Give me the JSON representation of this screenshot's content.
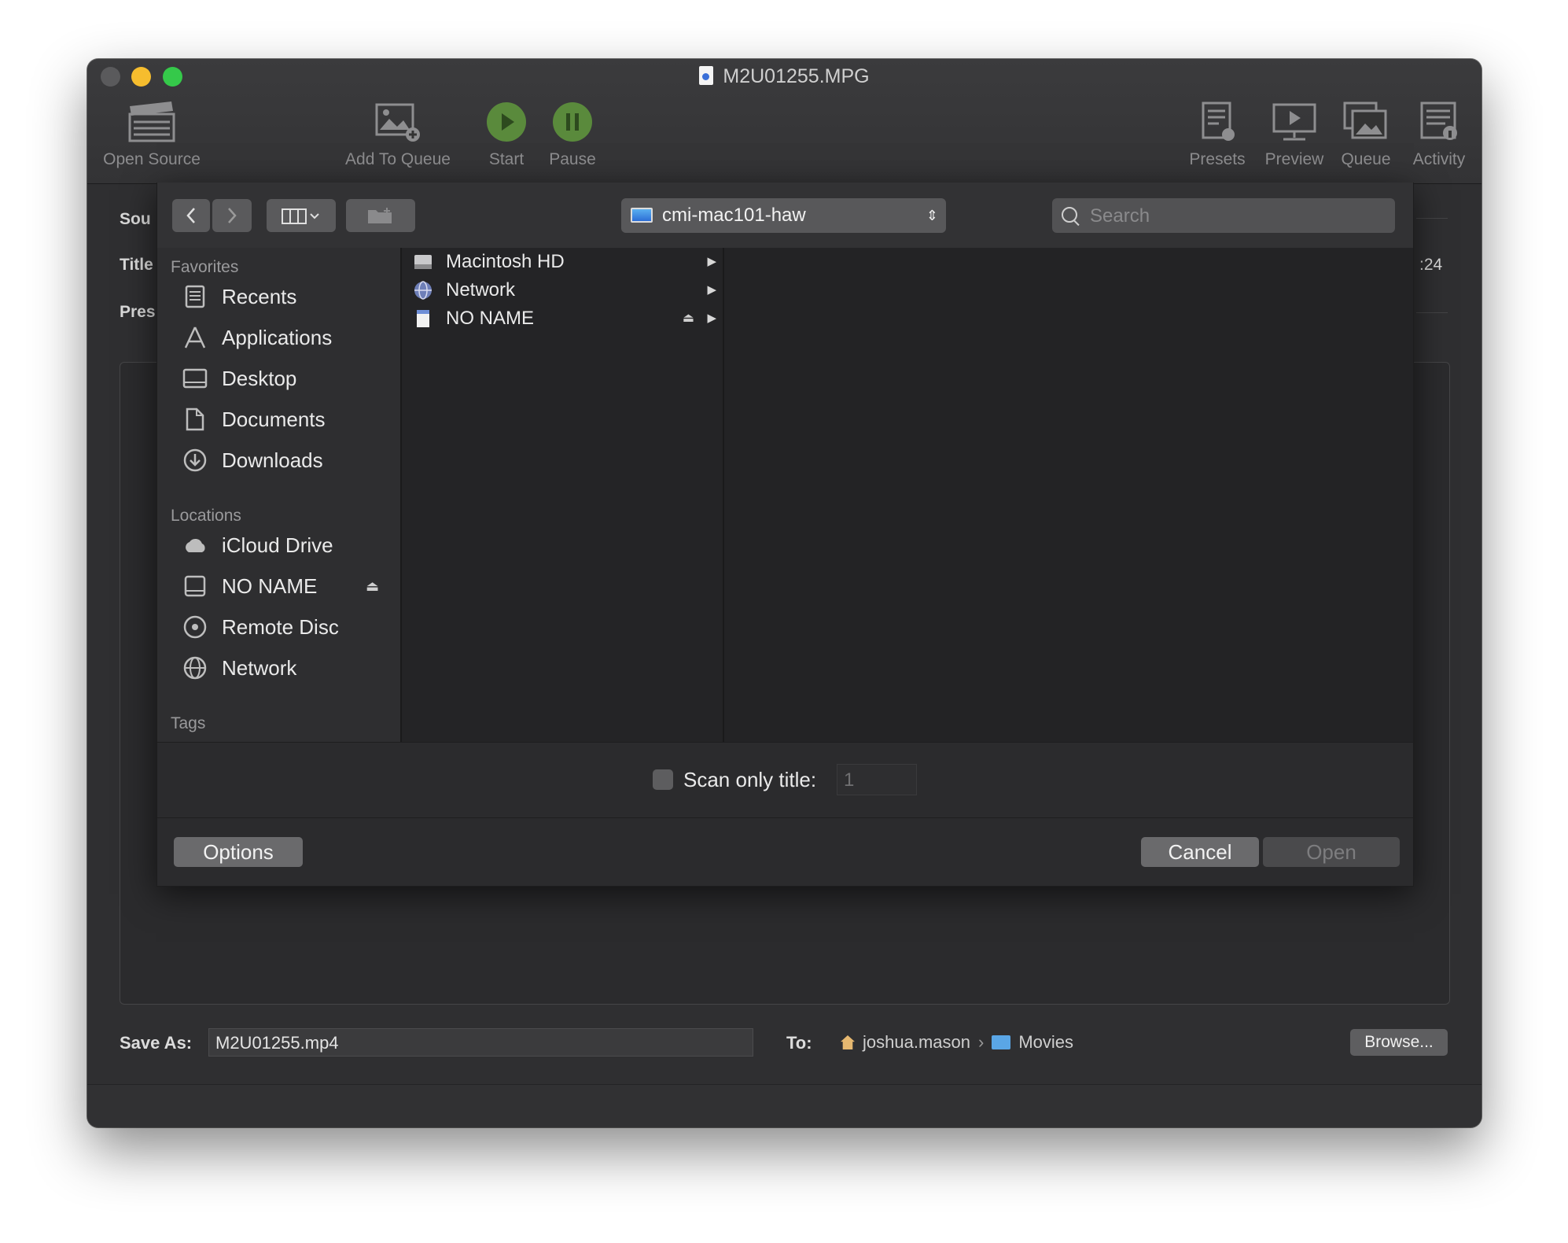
{
  "window": {
    "title": "M2U01255.MPG",
    "traffic_colors": {
      "close": "#5a5a5c",
      "minimize": "#f6bd2e",
      "maximize": "#35c94a"
    }
  },
  "toolbar": {
    "open_source": "Open Source",
    "add_to_queue": "Add To Queue",
    "start": "Start",
    "pause": "Pause",
    "presets": "Presets",
    "preview": "Preview",
    "queue": "Queue",
    "activity": "Activity"
  },
  "behind": {
    "source_label": "Sou",
    "title_label": "Title",
    "preset_label": "Pres",
    "duration_fragment": ":24",
    "save_as_label": "Save As:",
    "save_as_value": "M2U01255.mp4",
    "to_label": "To:",
    "path_user": "joshua.mason",
    "path_sep": "›",
    "path_folder": "Movies",
    "browse": "Browse..."
  },
  "dialog": {
    "location": "cmi-mac101-haw",
    "search_placeholder": "Search",
    "sidebar": {
      "favorites_heading": "Favorites",
      "favorites": [
        {
          "label": "Recents",
          "icon": "recents-icon"
        },
        {
          "label": "Applications",
          "icon": "applications-icon"
        },
        {
          "label": "Desktop",
          "icon": "desktop-icon"
        },
        {
          "label": "Documents",
          "icon": "documents-icon"
        },
        {
          "label": "Downloads",
          "icon": "downloads-icon"
        }
      ],
      "locations_heading": "Locations",
      "locations": [
        {
          "label": "iCloud Drive",
          "icon": "cloud-icon"
        },
        {
          "label": "NO NAME",
          "icon": "drive-icon",
          "eject": "⏏"
        },
        {
          "label": "Remote Disc",
          "icon": "disc-icon"
        },
        {
          "label": "Network",
          "icon": "network-icon"
        }
      ],
      "tags_heading": "Tags"
    },
    "column_items": [
      {
        "label": "Macintosh HD",
        "icon": "hard-drive-icon",
        "arrow": "▶"
      },
      {
        "label": "Network",
        "icon": "network-globe-icon",
        "arrow": "▶"
      },
      {
        "label": "NO NAME",
        "icon": "sd-card-icon",
        "arrow": "▶",
        "eject": "⏏"
      }
    ],
    "scan_only_title_label": "Scan only title:",
    "scan_title_value": "1",
    "options": "Options",
    "cancel": "Cancel",
    "open": "Open"
  }
}
